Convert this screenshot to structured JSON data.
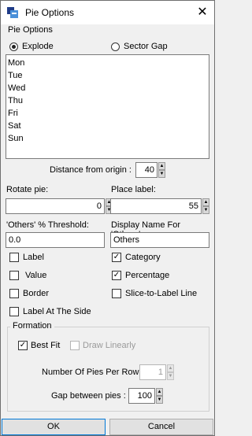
{
  "window": {
    "title": "Pie Options",
    "close_glyph": "✕"
  },
  "pie_options": {
    "section_label": "Pie Options",
    "explode_label": "Explode",
    "sector_gap_label": "Sector Gap",
    "selected": "Explode",
    "days": [
      "Mon",
      "Tue",
      "Wed",
      "Thu",
      "Fri",
      "Sat",
      "Sun"
    ]
  },
  "distance": {
    "label": "Distance from origin :",
    "value": "40"
  },
  "rotate": {
    "label": "Rotate pie:",
    "value": "0"
  },
  "place_label": {
    "label": "Place label:",
    "value": "55"
  },
  "threshold": {
    "label": "'Others' % Threshold:",
    "value": "0.0"
  },
  "others_name": {
    "label": "Display Name For 'Others':",
    "value": "Others"
  },
  "checkboxes": {
    "label": {
      "text": "Label",
      "checked": false
    },
    "category": {
      "text": "Category",
      "checked": true
    },
    "value": {
      "text": "Value",
      "checked": false
    },
    "percentage": {
      "text": "Percentage",
      "checked": true
    },
    "border": {
      "text": "Border",
      "checked": false
    },
    "slice_to_label": {
      "text": "Slice-to-Label Line",
      "checked": false
    },
    "label_at_side": {
      "text": "Label At The Side",
      "checked": false
    }
  },
  "formation": {
    "label": "Formation",
    "best_fit": {
      "text": "Best Fit",
      "checked": true
    },
    "draw_linearly": {
      "text": "Draw Linearly",
      "checked": false,
      "enabled": false
    },
    "pies_per_row": {
      "label": "Number Of Pies Per Row:",
      "value": "1"
    },
    "gap": {
      "label": "Gap between pies :",
      "value": "100"
    }
  },
  "buttons": {
    "ok": "OK",
    "cancel": "Cancel"
  },
  "icons": {
    "check": "✓",
    "spin_up": "▲",
    "spin_down": "▼",
    "app": "pie-chart-icon"
  },
  "colors": {
    "accent": "#0078d7",
    "app_icon_dark": "#1f3c88",
    "app_icon_light": "#4a90d9"
  }
}
